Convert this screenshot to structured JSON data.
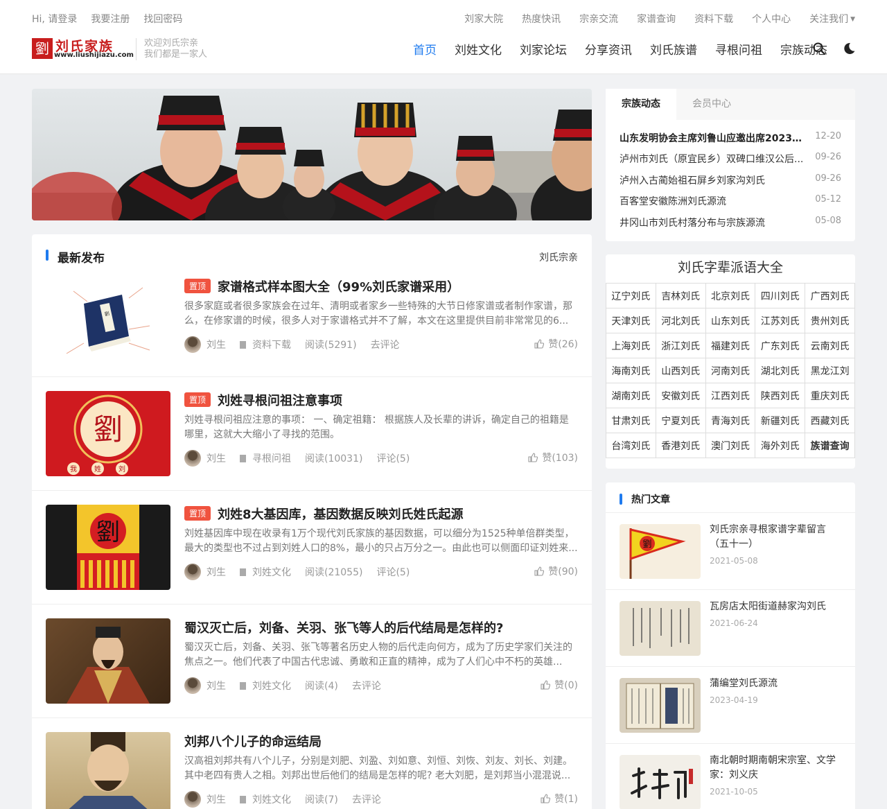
{
  "topbar": {
    "greeting": "Hi, 请登录",
    "register": "我要注册",
    "recover": "找回密码",
    "links": [
      "刘家大院",
      "热度快讯",
      "宗亲交流",
      "家谱查询",
      "资料下载",
      "个人中心",
      "关注我们"
    ]
  },
  "logo": {
    "char": "劉",
    "name": "刘氏家族",
    "url": "www.liushijiazu.com"
  },
  "slogan": {
    "line1": "欢迎刘氏宗亲",
    "line2": "我们都是一家人"
  },
  "nav": [
    "首页",
    "刘姓文化",
    "刘家论坛",
    "分享资讯",
    "刘氏族谱",
    "寻根问祖",
    "宗族动态"
  ],
  "icons": {
    "search": "search-icon",
    "theme": "moon-icon"
  },
  "latest": {
    "title": "最新发布",
    "right": "刘氏宗亲",
    "posts": [
      {
        "pinned": "置顶",
        "title": "家谱格式样本图大全（99%刘氏家谱采用）",
        "desc": "很多家庭或者很多家族会在过年、清明或者家乡一些特殊的大节日修家谱或者制作家谱，那么，在修家谱的时候，很多人对于家谱格式并不了解，本文在这里提供目前非常常见的6...",
        "author": "刘生",
        "category": "资料下载",
        "reads": "阅读(5291)",
        "comments": "去评论",
        "likes": "赞(26)"
      },
      {
        "pinned": "置顶",
        "title": "刘姓寻根问祖注意事项",
        "desc": "刘姓寻根问祖应注意的事项： 一、确定祖籍： 根据族人及长辈的讲诉，确定自己的祖籍是哪里，这就大大缩小了寻找的范围。",
        "author": "刘生",
        "category": "寻根问祖",
        "reads": "阅读(10031)",
        "comments": "评论(5)",
        "likes": "赞(103)"
      },
      {
        "pinned": "置顶",
        "title": "刘姓8大基因库，基因数据反映刘氏姓氏起源",
        "desc": "刘姓基因库中现在收录有1万个现代刘氏家族的基因数据，可以细分为1525种单倍群类型，最大的类型也不过占到刘姓人口的8%，最小的只占万分之一。由此也可以侧面印证刘姓来...",
        "author": "刘生",
        "category": "刘姓文化",
        "reads": "阅读(21055)",
        "comments": "评论(5)",
        "likes": "赞(90)"
      },
      {
        "pinned": "",
        "title": "蜀汉灭亡后，刘备、关羽、张飞等人的后代结局是怎样的?",
        "desc": "蜀汉灭亡后，刘备、关羽、张飞等著名历史人物的后代走向何方，成为了历史学家们关注的焦点之一。他们代表了中国古代忠诚、勇敢和正直的精神，成为了人们心中不朽的英雄...",
        "author": "刘生",
        "category": "刘姓文化",
        "reads": "阅读(4)",
        "comments": "去评论",
        "likes": "赞(0)"
      },
      {
        "pinned": "",
        "title": "刘邦八个儿子的命运结局",
        "desc": "汉高祖刘邦共有八个儿子，分别是刘肥、刘盈、刘如意、刘恒、刘恢、刘友、刘长、刘建。其中老四有贵人之相。刘邦出世后他们的结局是怎样的呢? 老大刘肥，是刘邦当小混混说...",
        "author": "刘生",
        "category": "刘姓文化",
        "reads": "阅读(7)",
        "comments": "去评论",
        "likes": "赞(1)"
      }
    ]
  },
  "sidebar_news": {
    "tab_active": "宗族动态",
    "tab_inactive": "会员中心",
    "items": [
      {
        "title": "山东发明协会主席刘鲁山应邀出席2023年...",
        "date": "12-20"
      },
      {
        "title": "泸州市刘氏（原宜民乡）双碑口维汉公后...",
        "date": "09-26"
      },
      {
        "title": "泸州入古蔺始祖石屏乡刘家沟刘氏",
        "date": "09-26"
      },
      {
        "title": "百客堂安徽陈洲刘氏源流",
        "date": "05-12"
      },
      {
        "title": "井冈山市刘氏村落分布与宗族源流",
        "date": "05-08"
      }
    ]
  },
  "paiyu": {
    "title": "刘氏字辈派语大全",
    "rows": [
      [
        "辽宁刘氏",
        "吉林刘氏",
        "北京刘氏",
        "四川刘氏",
        "广西刘氏"
      ],
      [
        "天津刘氏",
        "河北刘氏",
        "山东刘氏",
        "江苏刘氏",
        "贵州刘氏"
      ],
      [
        "上海刘氏",
        "浙江刘氏",
        "福建刘氏",
        "广东刘氏",
        "云南刘氏"
      ],
      [
        "海南刘氏",
        "山西刘氏",
        "河南刘氏",
        "湖北刘氏",
        "黑龙江刘"
      ],
      [
        "湖南刘氏",
        "安徽刘氏",
        "江西刘氏",
        "陕西刘氏",
        "重庆刘氏"
      ],
      [
        "甘肃刘氏",
        "宁夏刘氏",
        "青海刘氏",
        "新疆刘氏",
        "西藏刘氏"
      ],
      [
        "台湾刘氏",
        "香港刘氏",
        "澳门刘氏",
        "海外刘氏",
        "族谱查询"
      ]
    ]
  },
  "hot": {
    "title": "热门文章",
    "items": [
      {
        "title": "刘氏宗亲寻根家谱字辈留言（五十一）",
        "date": "2021-05-08"
      },
      {
        "title": "瓦房店太阳街道赫家沟刘氏",
        "date": "2021-06-24"
      },
      {
        "title": "蒲编堂刘氏源流",
        "date": "2023-04-19"
      },
      {
        "title": "南北朝时期南朝宋宗室、文学家：刘义庆",
        "date": "2021-10-05"
      }
    ]
  },
  "colors": {
    "accent": "#1f7bef",
    "pinned": "#f0533f",
    "brand": "#c81d1d"
  }
}
